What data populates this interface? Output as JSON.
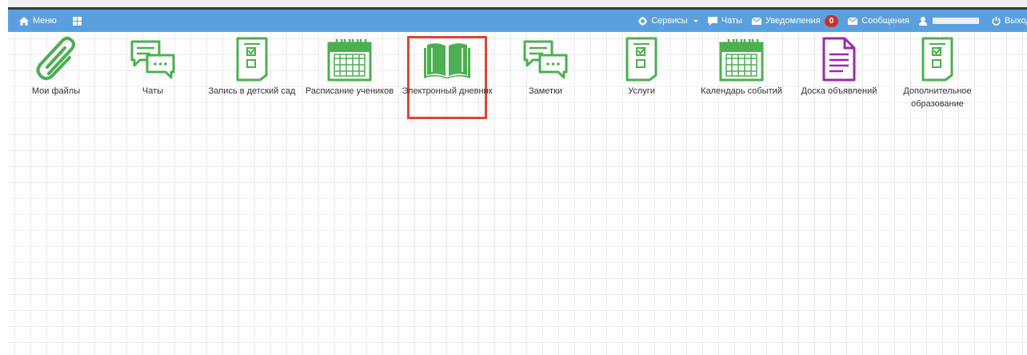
{
  "navbar": {
    "menu_label": "Меню",
    "services_label": "Сервисы",
    "chats_label": "Чаты",
    "notifications_label": "Уведомления",
    "notifications_count": "0",
    "messages_label": "Сообщения",
    "logout_label": "Выход"
  },
  "tiles": [
    {
      "label": "Мои файлы",
      "icon": "paperclip-icon"
    },
    {
      "label": "Чаты",
      "icon": "chat-bubbles-icon"
    },
    {
      "label": "Запись в детский сад",
      "icon": "checklist-document-icon"
    },
    {
      "label": "Расписание учеников",
      "icon": "calendar-icon"
    },
    {
      "label": "Электронный дневник",
      "icon": "open-book-icon"
    },
    {
      "label": "Заметки",
      "icon": "chat-bubbles-icon"
    },
    {
      "label": "Услуги",
      "icon": "checklist-document-icon"
    },
    {
      "label": "Календарь событий",
      "icon": "calendar-icon"
    },
    {
      "label": "Доска объявлений",
      "icon": "text-document-icon"
    },
    {
      "label": "Дополнительное образование",
      "icon": "checklist-document-icon"
    }
  ],
  "colors": {
    "navbar": "#5aa0de",
    "icon_green": "#4caf50",
    "icon_purple": "#9c27b0",
    "highlight": "#d9463a",
    "badge": "#c9302c"
  }
}
